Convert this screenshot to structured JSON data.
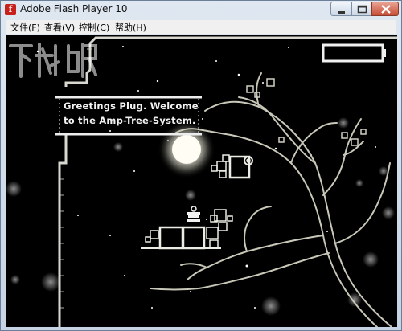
{
  "window": {
    "title": "Adobe Flash Player 10",
    "app_icon_glyph": "f"
  },
  "menu": {
    "file": "文件(F)",
    "view": "查看(V)",
    "control": "控制(C)",
    "help": "帮助(H)"
  },
  "game": {
    "dialog_line1": "Greetings Plug. Welcome",
    "dialog_line2": "to the Amp-Tree-System.",
    "battery_icon": "battery-icon",
    "robot_icon": "plug-robot-icon",
    "colors": {
      "background": "#000000",
      "wall": "#d8d8d0",
      "tree": "#c9c8b8",
      "glow": "#fffbe8"
    }
  },
  "watermark": {
    "text": "下载吧"
  }
}
